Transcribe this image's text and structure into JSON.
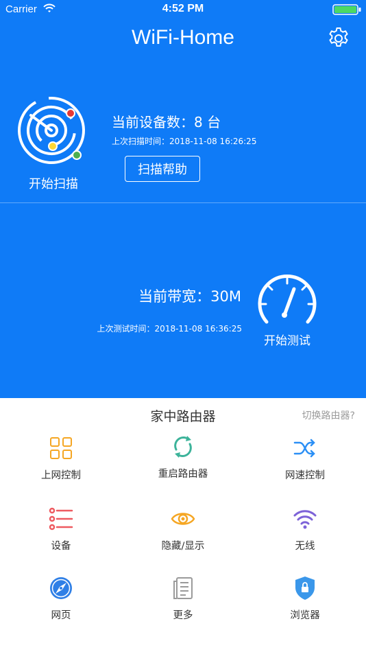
{
  "status_bar": {
    "carrier": "Carrier",
    "time": "4:52 PM"
  },
  "header": {
    "title": "WiFi-Home"
  },
  "scan": {
    "device_count": "当前设备数：8 台",
    "last_scan": "上次扫描时间：2018-11-08 16:26:25",
    "start_label": "开始扫描",
    "help_label": "扫描帮助"
  },
  "speed": {
    "bandwidth": "当前带宽：30M",
    "last_test": "上次测试时间：2018-11-08 16:36:25",
    "start_label": "开始测试"
  },
  "router": {
    "title": "家中路由器",
    "switch_label": "切换路由器?",
    "items": [
      {
        "label": "上网控制",
        "icon": "grid-icon",
        "color": "#f5a623"
      },
      {
        "label": "重启路由器",
        "icon": "refresh-icon",
        "color": "#3cb39a"
      },
      {
        "label": "网速控制",
        "icon": "shuffle-icon",
        "color": "#2b8ff5"
      },
      {
        "label": "设备",
        "icon": "list-icon",
        "color": "#ee5a60"
      },
      {
        "label": "隐藏/显示",
        "icon": "eye-icon",
        "color": "#f5a623"
      },
      {
        "label": "无线",
        "icon": "wifi-icon",
        "color": "#7d63d8"
      },
      {
        "label": "网页",
        "icon": "compass-icon",
        "color": "#2f7fe6"
      },
      {
        "label": "更多",
        "icon": "document-icon",
        "color": "#9a9a9a"
      },
      {
        "label": "浏览器",
        "icon": "shield-lock-icon",
        "color": "#3a97ea"
      }
    ]
  },
  "colors": {
    "primary": "#0f7bf7",
    "text_dark": "#333333",
    "text_muted": "#9a9a9a"
  }
}
